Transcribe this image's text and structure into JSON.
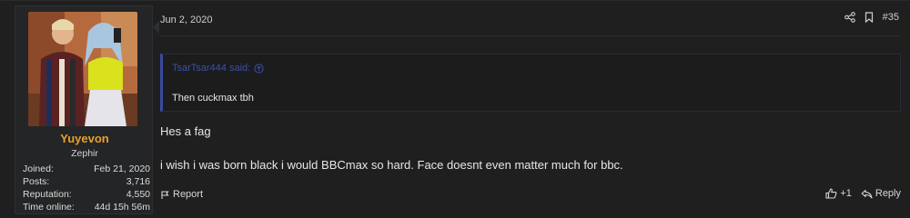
{
  "post": {
    "date": "Jun 2, 2020",
    "number": "#35",
    "icons": {
      "share": "share-icon",
      "bookmark": "bookmark-icon"
    }
  },
  "user": {
    "name": "Yuyevon",
    "title": "Zephir",
    "stats": [
      {
        "label": "Joined:",
        "value": "Feb 21, 2020"
      },
      {
        "label": "Posts:",
        "value": "3,716"
      },
      {
        "label": "Reputation:",
        "value": "4,550"
      },
      {
        "label": "Time online:",
        "value": "44d 15h 56m"
      }
    ]
  },
  "quote": {
    "author": "TsarTsar444 said:",
    "body": "Then cuckmax tbh"
  },
  "message": {
    "line1": "Hes a fag",
    "line2": "i wish i was born black i would BBCmax so hard. Face doesnt even matter much for bbc."
  },
  "footer": {
    "report_label": "Report",
    "like_count": "+1",
    "reply_label": "Reply"
  },
  "colors": {
    "username": "#e8a12d",
    "quote_accent": "#3a49a0",
    "background": "#1f1f20"
  }
}
